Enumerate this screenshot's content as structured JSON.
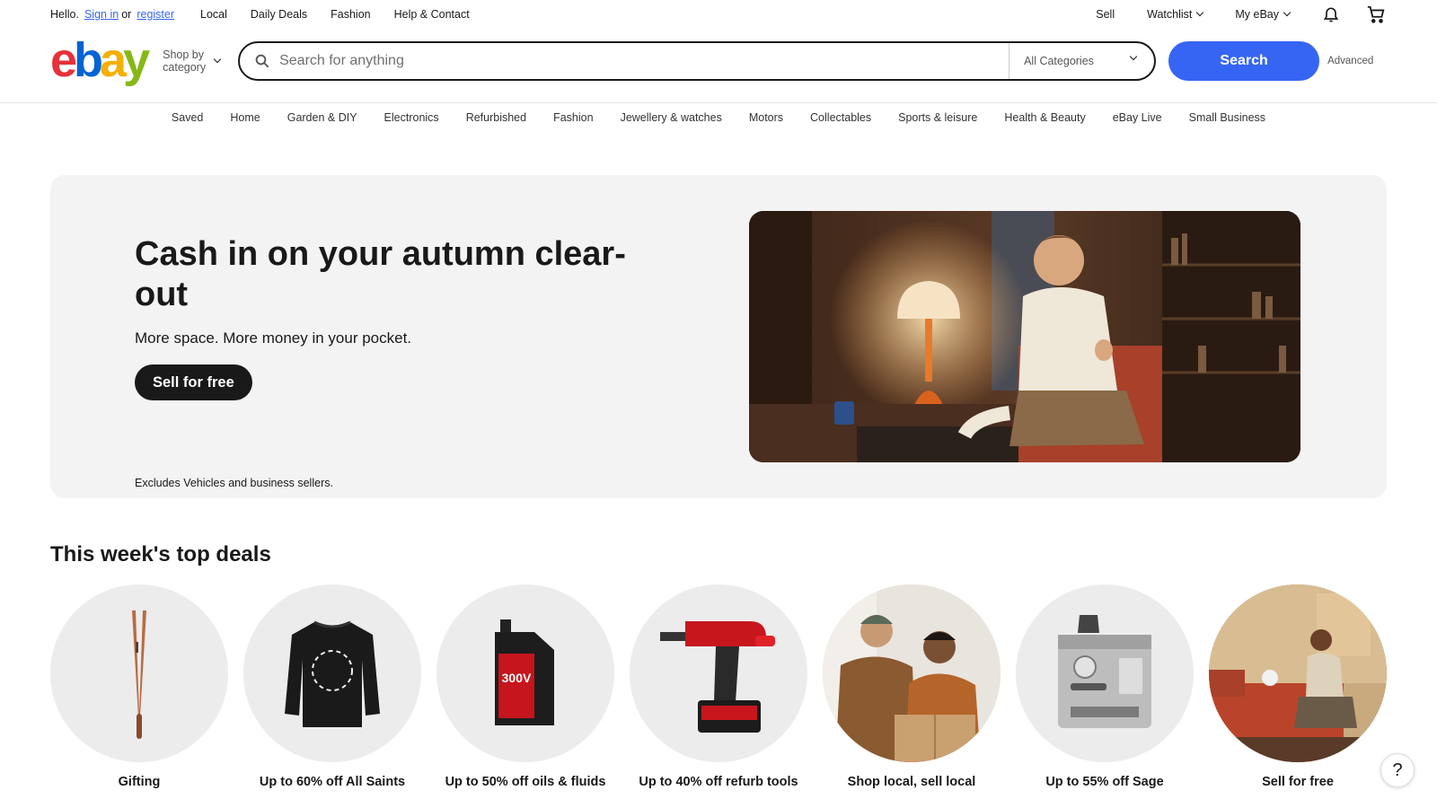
{
  "topbar": {
    "hello": "Hello.",
    "sign_in": "Sign in",
    "or": "or",
    "register": "register",
    "links": [
      "Local",
      "Daily Deals",
      "Fashion",
      "Help & Contact"
    ],
    "sell": "Sell",
    "watchlist": "Watchlist",
    "my_ebay": "My eBay"
  },
  "header": {
    "logo_letters": [
      "e",
      "b",
      "a",
      "y"
    ],
    "shop_by_line1": "Shop by",
    "shop_by_line2": "category",
    "search_placeholder": "Search for anything",
    "category_select": "All Categories",
    "search_button": "Search",
    "advanced": "Advanced"
  },
  "category_nav": [
    "Saved",
    "Home",
    "Garden & DIY",
    "Electronics",
    "Refurbished",
    "Fashion",
    "Jewellery & watches",
    "Motors",
    "Collectables",
    "Sports & leisure",
    "Health & Beauty",
    "eBay Live",
    "Small Business"
  ],
  "hero": {
    "title": "Cash in on your autumn clear-out",
    "subtitle": "More space. More money in your pocket.",
    "cta": "Sell for free",
    "note": "Excludes Vehicles and business sellers."
  },
  "deals": {
    "title": "This week's top deals",
    "items": [
      {
        "label": "Gifting",
        "icon": "hair-styler-image"
      },
      {
        "label": "Up to 60% off All Saints",
        "icon": "sweater-image"
      },
      {
        "label": "Up to 50% off oils & fluids",
        "icon": "motor-oil-image"
      },
      {
        "label": "Up to 40% off refurb tools",
        "icon": "drill-image"
      },
      {
        "label": "Shop local, sell local",
        "icon": "people-parcel-image"
      },
      {
        "label": "Up to 55% off Sage",
        "icon": "coffee-machine-image"
      },
      {
        "label": "Sell for free",
        "icon": "living-room-image"
      }
    ]
  },
  "help": "?",
  "colors": {
    "search_blue": "#3665f3",
    "logo_red": "#e53238",
    "logo_blue": "#0064d2",
    "logo_yellow": "#f5af02",
    "logo_green": "#86b817",
    "hero_bg": "#f3f3f3"
  }
}
